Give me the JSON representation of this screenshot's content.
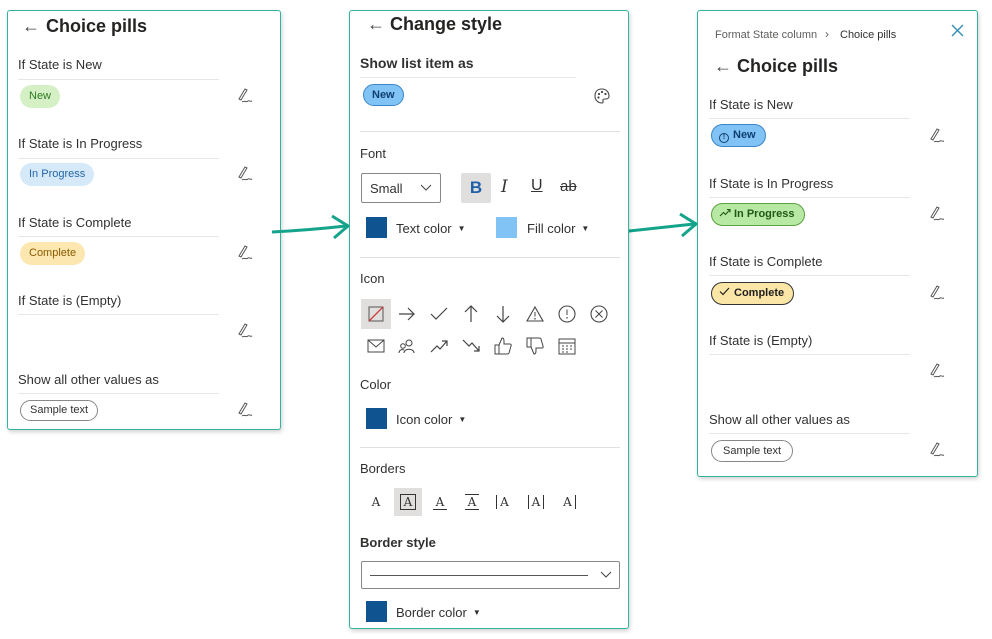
{
  "panel1": {
    "title": "Choice pills",
    "rows": [
      {
        "label": "If State is New",
        "pill": "New"
      },
      {
        "label": "If State is In Progress",
        "pill": "In Progress"
      },
      {
        "label": "If State is Complete",
        "pill": "Complete"
      },
      {
        "label": "If State is (Empty)",
        "pill": ""
      },
      {
        "label": "Show all other values as",
        "pill": "Sample text"
      }
    ]
  },
  "panel2": {
    "title": "Change style",
    "show_list_item_label": "Show list item as",
    "preview_pill": "New",
    "font_section": "Font",
    "font_size": "Small",
    "bold": "B",
    "italic": "I",
    "underline": "U",
    "strike": "ab",
    "text_color_label": "Text color",
    "fill_color_label": "Fill color",
    "icon_section": "Icon",
    "color_section": "Color",
    "icon_color_label": "Icon color",
    "borders_section": "Borders",
    "border_glyph": "A",
    "border_style_section": "Border style",
    "border_color_label": "Border color",
    "colors": {
      "text": "#0f5490",
      "fill": "#82c3f5",
      "icon": "#0f5490",
      "border": "#0f5490"
    }
  },
  "panel3": {
    "breadcrumb_parent": "Format State column",
    "breadcrumb_current": "Choice pills",
    "title": "Choice pills",
    "rows": [
      {
        "label": "If State is New",
        "pill": "New"
      },
      {
        "label": "If State is In Progress",
        "pill": "In Progress"
      },
      {
        "label": "If State is Complete",
        "pill": "Complete"
      },
      {
        "label": "If State is (Empty)",
        "pill": ""
      },
      {
        "label": "Show all other values as",
        "pill": "Sample text"
      }
    ]
  }
}
